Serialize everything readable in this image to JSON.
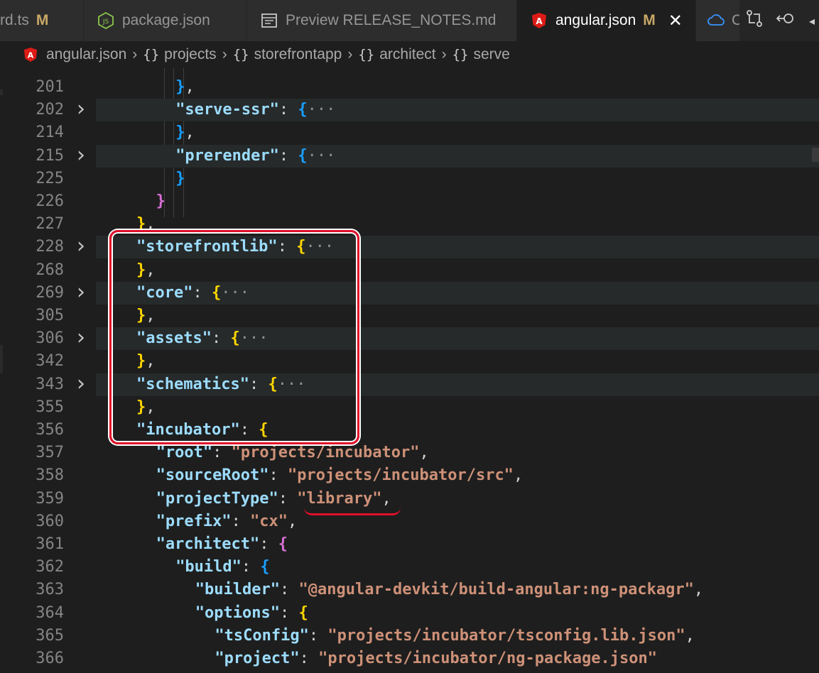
{
  "tabs": [
    {
      "label": "rd.ts",
      "modified": "M",
      "icon": "typescript-icon",
      "active": false
    },
    {
      "label": "package.json",
      "modified": "",
      "icon": "nodejs-icon",
      "active": false
    },
    {
      "label": "Preview RELEASE_NOTES.md",
      "modified": "",
      "icon": "preview-icon",
      "active": false
    },
    {
      "label": "angular.json",
      "modified": "M",
      "icon": "angular-icon",
      "active": true
    },
    {
      "label": "C",
      "modified": "",
      "icon": "cloud-icon",
      "active": false
    }
  ],
  "toolbar": {
    "compare_icon": "⟲",
    "timeline_icon": "⟳"
  },
  "breadcrumb": {
    "file": "angular.json",
    "items": [
      "projects",
      "storefrontapp",
      "architect",
      "serve"
    ]
  },
  "colors": {
    "key": "#9cdcfe",
    "string": "#ce9178",
    "bracket1": "#ffd700",
    "bracket2": "#da70d6",
    "bracket3": "#179fff",
    "annotation": "#e0102a"
  },
  "lines": [
    {
      "n": "201",
      "indent": 9,
      "parts": [
        [
          "b3",
          "}"
        ],
        [
          "p",
          ","
        ]
      ]
    },
    {
      "n": "202",
      "indent": 9,
      "fold": true,
      "parts": [
        [
          "k",
          "\"serve-ssr\""
        ],
        [
          "p",
          ": "
        ],
        [
          "b3",
          "{"
        ],
        [
          "ell",
          "···"
        ]
      ]
    },
    {
      "n": "214",
      "indent": 9,
      "parts": [
        [
          "b3",
          "}"
        ],
        [
          "p",
          ","
        ]
      ]
    },
    {
      "n": "215",
      "indent": 9,
      "fold": true,
      "parts": [
        [
          "k",
          "\"prerender\""
        ],
        [
          "p",
          ": "
        ],
        [
          "b3",
          "{"
        ],
        [
          "ell",
          "···"
        ]
      ]
    },
    {
      "n": "225",
      "indent": 9,
      "parts": [
        [
          "b3",
          "}"
        ]
      ]
    },
    {
      "n": "226",
      "indent": 8,
      "parts": [
        [
          "b2",
          "}"
        ]
      ]
    },
    {
      "n": "227",
      "indent": 7,
      "parts": [
        [
          "b1",
          "}"
        ],
        [
          "p",
          ","
        ]
      ]
    },
    {
      "n": "228",
      "indent": 7,
      "fold": true,
      "parts": [
        [
          "k",
          "\"storefrontlib\""
        ],
        [
          "p",
          ": "
        ],
        [
          "b1",
          "{"
        ],
        [
          "ell",
          "···"
        ]
      ]
    },
    {
      "n": "268",
      "indent": 7,
      "parts": [
        [
          "b1",
          "}"
        ],
        [
          "p",
          ","
        ]
      ]
    },
    {
      "n": "269",
      "indent": 7,
      "fold": true,
      "parts": [
        [
          "k",
          "\"core\""
        ],
        [
          "p",
          ": "
        ],
        [
          "b1",
          "{"
        ],
        [
          "ell",
          "···"
        ]
      ]
    },
    {
      "n": "305",
      "indent": 7,
      "parts": [
        [
          "b1",
          "}"
        ],
        [
          "p",
          ","
        ]
      ]
    },
    {
      "n": "306",
      "indent": 7,
      "fold": true,
      "parts": [
        [
          "k",
          "\"assets\""
        ],
        [
          "p",
          ": "
        ],
        [
          "b1",
          "{"
        ],
        [
          "ell",
          "···"
        ]
      ]
    },
    {
      "n": "342",
      "indent": 7,
      "parts": [
        [
          "b1",
          "}"
        ],
        [
          "p",
          ","
        ]
      ]
    },
    {
      "n": "343",
      "indent": 7,
      "fold": true,
      "parts": [
        [
          "k",
          "\"schematics\""
        ],
        [
          "p",
          ": "
        ],
        [
          "b1",
          "{"
        ],
        [
          "ell",
          "···"
        ]
      ]
    },
    {
      "n": "355",
      "indent": 7,
      "parts": [
        [
          "b1",
          "}"
        ],
        [
          "p",
          ","
        ]
      ]
    },
    {
      "n": "356",
      "indent": 7,
      "parts": [
        [
          "k",
          "\"incubator\""
        ],
        [
          "p",
          ": "
        ],
        [
          "b1",
          "{"
        ]
      ]
    },
    {
      "n": "357",
      "indent": 8,
      "parts": [
        [
          "k",
          "\"root\""
        ],
        [
          "p",
          ": "
        ],
        [
          "s",
          "\"projects/incubator\""
        ],
        [
          "p",
          ","
        ]
      ]
    },
    {
      "n": "358",
      "indent": 8,
      "parts": [
        [
          "k",
          "\"sourceRoot\""
        ],
        [
          "p",
          ": "
        ],
        [
          "s",
          "\"projects/incubator/src\""
        ],
        [
          "p",
          ","
        ]
      ]
    },
    {
      "n": "359",
      "indent": 8,
      "parts": [
        [
          "k",
          "\"projectType\""
        ],
        [
          "p",
          ": "
        ],
        [
          "s",
          "\"library\""
        ],
        [
          "p",
          ","
        ]
      ]
    },
    {
      "n": "360",
      "indent": 8,
      "parts": [
        [
          "k",
          "\"prefix\""
        ],
        [
          "p",
          ": "
        ],
        [
          "s",
          "\"cx\""
        ],
        [
          "p",
          ","
        ]
      ]
    },
    {
      "n": "361",
      "indent": 8,
      "parts": [
        [
          "k",
          "\"architect\""
        ],
        [
          "p",
          ": "
        ],
        [
          "b2",
          "{"
        ]
      ]
    },
    {
      "n": "362",
      "indent": 9,
      "parts": [
        [
          "k",
          "\"build\""
        ],
        [
          "p",
          ": "
        ],
        [
          "b3",
          "{"
        ]
      ]
    },
    {
      "n": "363",
      "indent": 10,
      "parts": [
        [
          "k",
          "\"builder\""
        ],
        [
          "p",
          ": "
        ],
        [
          "s",
          "\"@angular-devkit/build-angular:ng-packagr\""
        ],
        [
          "p",
          ","
        ]
      ]
    },
    {
      "n": "364",
      "indent": 10,
      "parts": [
        [
          "k",
          "\"options\""
        ],
        [
          "p",
          ": "
        ],
        [
          "b1",
          "{"
        ]
      ]
    },
    {
      "n": "365",
      "indent": 11,
      "parts": [
        [
          "k",
          "\"tsConfig\""
        ],
        [
          "p",
          ": "
        ],
        [
          "s",
          "\"projects/incubator/tsconfig.lib.json\""
        ],
        [
          "p",
          ","
        ]
      ]
    },
    {
      "n": "366",
      "indent": 11,
      "parts": [
        [
          "k",
          "\"project\""
        ],
        [
          "p",
          ": "
        ],
        [
          "s",
          "\"projects/incubator/ng-package.json\""
        ]
      ]
    }
  ]
}
